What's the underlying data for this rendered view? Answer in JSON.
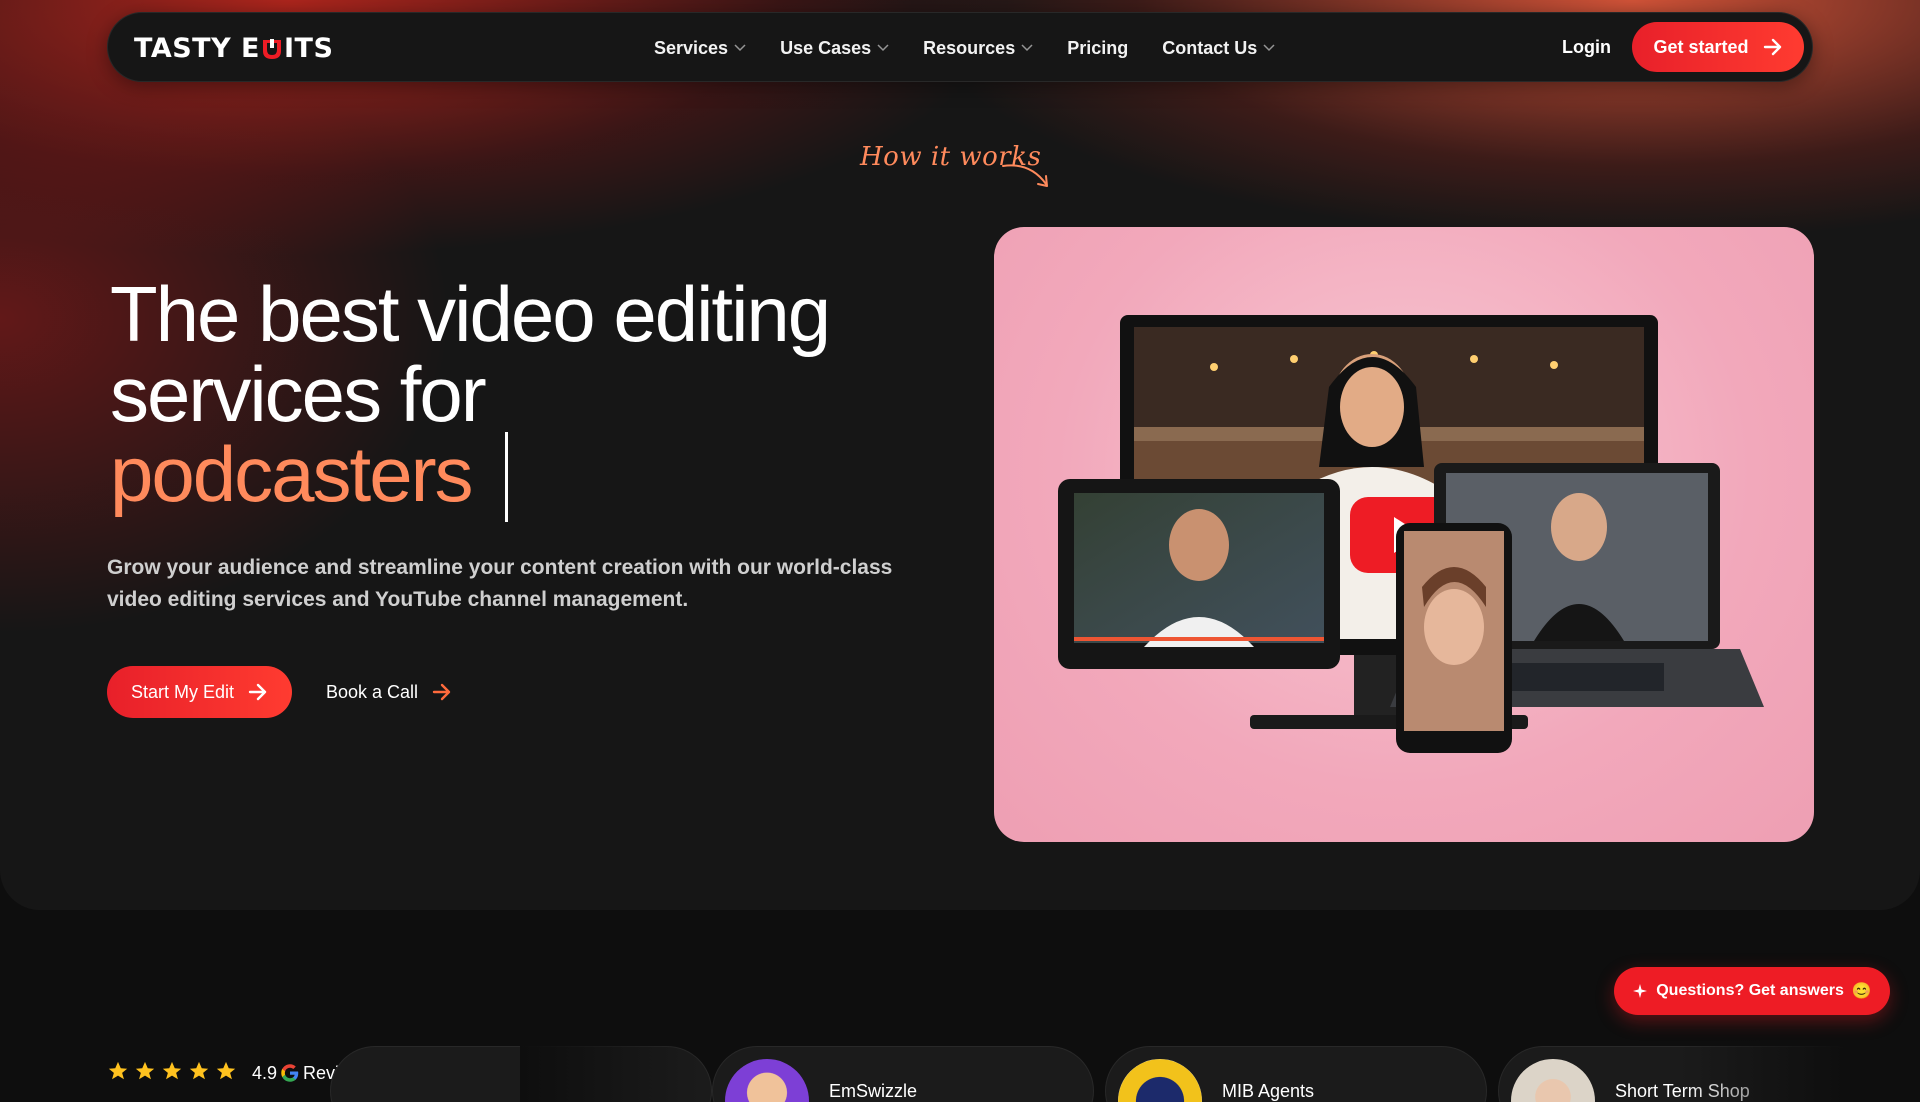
{
  "nav": {
    "logo_left": "TASTY E",
    "logo_right": "ITS",
    "menu": [
      {
        "label": "Services",
        "has_dropdown": true
      },
      {
        "label": "Use Cases",
        "has_dropdown": true
      },
      {
        "label": "Resources",
        "has_dropdown": true
      },
      {
        "label": "Pricing",
        "has_dropdown": false
      },
      {
        "label": "Contact Us",
        "has_dropdown": true
      }
    ],
    "login": "Login",
    "cta": "Get started"
  },
  "hero": {
    "how_it_works": "How it works",
    "headline_line1": "The best video editing",
    "headline_line2": "services for",
    "headline_accent": "podcasters",
    "subtext": "Grow your audience and streamline your content creation with our world-class video editing services and YouTube channel management.",
    "primary_button": "Start My Edit",
    "secondary_button": "Book a Call"
  },
  "reviews": {
    "stars": 5,
    "score": "4.9",
    "label": "Reviews",
    "clients": [
      {
        "name": "EmSwizzle"
      },
      {
        "name": "MIB Agents"
      },
      {
        "name": "Short Term Shop"
      }
    ]
  },
  "chat": {
    "label": "Questions? Get answers",
    "emoji": "😊"
  },
  "colors": {
    "accent_red": "#ee1c25",
    "accent_orange": "#ff8a5c",
    "background": "#0e0e0e"
  }
}
